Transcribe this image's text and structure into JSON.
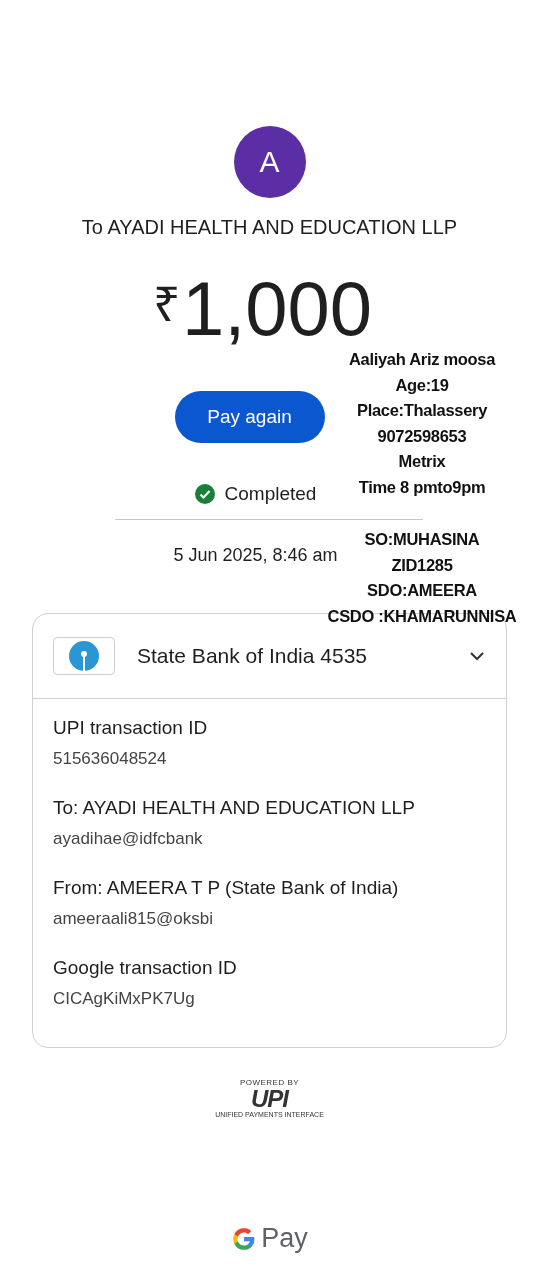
{
  "avatar": {
    "initial": "A"
  },
  "recipient": "To AYADI HEALTH AND EDUCATION LLP",
  "amount": {
    "currency": "₹",
    "value": "1,000"
  },
  "pay_again_button": "Pay again",
  "status": {
    "kind": "completed",
    "label": "Completed"
  },
  "datetime": "5 Jun 2025, 8:46 am",
  "account": {
    "name": "State Bank of India 4535",
    "expanded": true
  },
  "details": [
    {
      "label": "UPI transaction ID",
      "value": "515636048524"
    },
    {
      "label": "To: AYADI HEALTH AND EDUCATION LLP",
      "value": "ayadihae@idfcbank"
    },
    {
      "label": "From: AMEERA  T P (State Bank of India)",
      "value": "ameeraali815@oksbi"
    },
    {
      "label": "Google transaction ID",
      "value": "CICAgKiMxPK7Ug"
    }
  ],
  "upi_logo": {
    "powered_by": "POWERED BY",
    "name": "UPI",
    "tagline": "UNIFIED PAYMENTS INTERFACE"
  },
  "footer": {
    "brand": "Pay"
  },
  "annotation": [
    [
      "Aaliyah Ariz moosa",
      "Age:19",
      "Place:Thalassery",
      "9072598653",
      "Metrix",
      "Time 8 pmto9pm"
    ],
    [
      "SO:MUHASINA",
      "ZID1285",
      "SDO:AMEERA",
      "CSDO :KHAMARUNNISA"
    ]
  ]
}
